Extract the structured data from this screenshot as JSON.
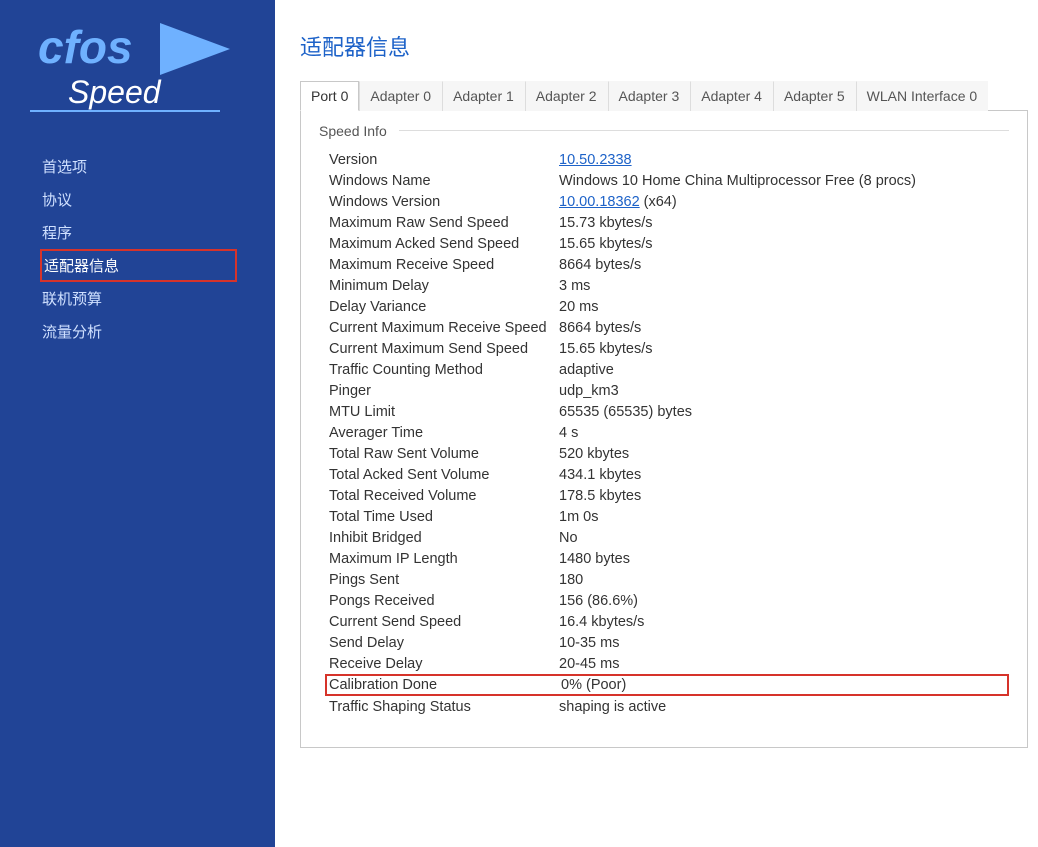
{
  "app": {
    "logo_top": "cfos",
    "logo_bottom": "Speed"
  },
  "sidebar": {
    "items": [
      {
        "label": "首选项",
        "selected": false
      },
      {
        "label": "协议",
        "selected": false
      },
      {
        "label": "程序",
        "selected": false
      },
      {
        "label": "适配器信息",
        "selected": true
      },
      {
        "label": "联机预算",
        "selected": false
      },
      {
        "label": "流量分析",
        "selected": false
      }
    ]
  },
  "page": {
    "title": "适配器信息",
    "tabs": [
      {
        "label": "Port 0",
        "active": true
      },
      {
        "label": "Adapter 0",
        "active": false
      },
      {
        "label": "Adapter 1",
        "active": false
      },
      {
        "label": "Adapter 2",
        "active": false
      },
      {
        "label": "Adapter 3",
        "active": false
      },
      {
        "label": "Adapter 4",
        "active": false
      },
      {
        "label": "Adapter 5",
        "active": false
      },
      {
        "label": "WLAN Interface 0",
        "active": false
      }
    ],
    "section_title": "Speed Info",
    "rows": [
      {
        "label": "Version",
        "value": "10.50.2338",
        "link": true,
        "extra": "",
        "hl": false
      },
      {
        "label": "Windows Name",
        "value": "Windows 10 Home China Multiprocessor Free (8 procs)",
        "link": false,
        "extra": "",
        "hl": false
      },
      {
        "label": "Windows Version",
        "value": "10.00.18362",
        "link": true,
        "extra": " (x64)",
        "hl": false
      },
      {
        "label": "Maximum Raw Send Speed",
        "value": "15.73 kbytes/s",
        "link": false,
        "extra": "",
        "hl": false
      },
      {
        "label": "Maximum Acked Send Speed",
        "value": "15.65 kbytes/s",
        "link": false,
        "extra": "",
        "hl": false
      },
      {
        "label": "Maximum Receive Speed",
        "value": "8664 bytes/s",
        "link": false,
        "extra": "",
        "hl": false
      },
      {
        "label": "Minimum Delay",
        "value": "3 ms",
        "link": false,
        "extra": "",
        "hl": false
      },
      {
        "label": "Delay Variance",
        "value": "20 ms",
        "link": false,
        "extra": "",
        "hl": false
      },
      {
        "label": "Current Maximum Receive Speed",
        "value": "8664 bytes/s",
        "link": false,
        "extra": "",
        "hl": false
      },
      {
        "label": "Current Maximum Send Speed",
        "value": "15.65 kbytes/s",
        "link": false,
        "extra": "",
        "hl": false
      },
      {
        "label": "Traffic Counting Method",
        "value": "adaptive",
        "link": false,
        "extra": "",
        "hl": false
      },
      {
        "label": "Pinger",
        "value": "udp_km3",
        "link": false,
        "extra": "",
        "hl": false
      },
      {
        "label": "MTU Limit",
        "value": "65535 (65535) bytes",
        "link": false,
        "extra": "",
        "hl": false
      },
      {
        "label": "Averager Time",
        "value": "4 s",
        "link": false,
        "extra": "",
        "hl": false
      },
      {
        "label": "Total Raw Sent Volume",
        "value": "520 kbytes",
        "link": false,
        "extra": "",
        "hl": false
      },
      {
        "label": "Total Acked Sent Volume",
        "value": "434.1 kbytes",
        "link": false,
        "extra": "",
        "hl": false
      },
      {
        "label": "Total Received Volume",
        "value": "178.5 kbytes",
        "link": false,
        "extra": "",
        "hl": false
      },
      {
        "label": "Total Time Used",
        "value": "1m 0s",
        "link": false,
        "extra": "",
        "hl": false
      },
      {
        "label": "Inhibit Bridged",
        "value": "No",
        "link": false,
        "extra": "",
        "hl": false
      },
      {
        "label": "Maximum IP Length",
        "value": "1480 bytes",
        "link": false,
        "extra": "",
        "hl": false
      },
      {
        "label": "Pings Sent",
        "value": "180",
        "link": false,
        "extra": "",
        "hl": false
      },
      {
        "label": "Pongs Received",
        "value": "156 (86.6%)",
        "link": false,
        "extra": "",
        "hl": false
      },
      {
        "label": "Current Send Speed",
        "value": "16.4 kbytes/s",
        "link": false,
        "extra": "",
        "hl": false
      },
      {
        "label": "Send Delay",
        "value": "10-35 ms",
        "link": false,
        "extra": "",
        "hl": false
      },
      {
        "label": "Receive Delay",
        "value": "20-45 ms",
        "link": false,
        "extra": "",
        "hl": false
      },
      {
        "label": "Calibration Done",
        "value": "0% (Poor)",
        "link": false,
        "extra": "",
        "hl": true
      },
      {
        "label": "Traffic Shaping Status",
        "value": "shaping is active",
        "link": false,
        "extra": "",
        "hl": false
      }
    ]
  }
}
